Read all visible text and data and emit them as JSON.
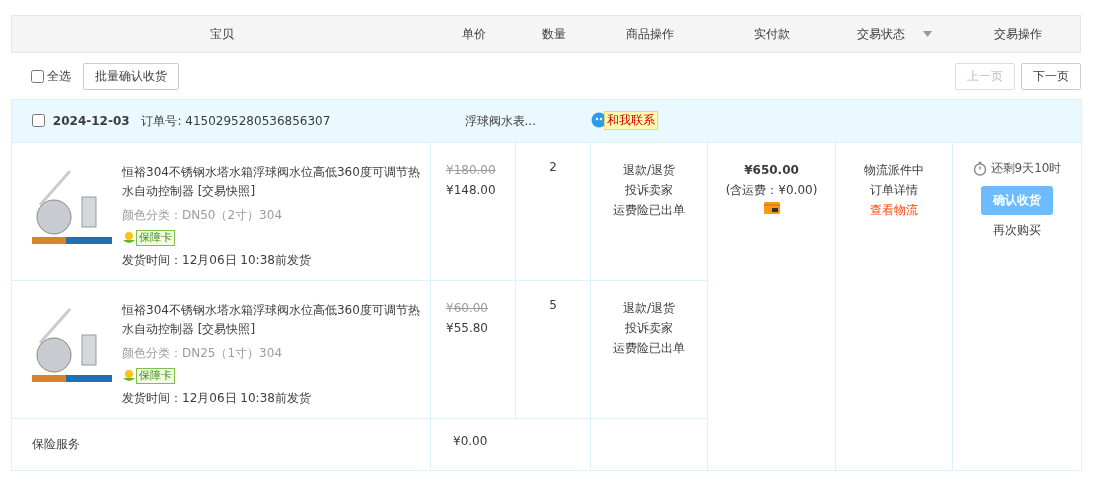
{
  "columns": [
    {
      "label": "宝贝",
      "dropdown": false
    },
    {
      "label": "单价",
      "dropdown": false
    },
    {
      "label": "数量",
      "dropdown": false
    },
    {
      "label": "商品操作",
      "dropdown": false
    },
    {
      "label": "实付款",
      "dropdown": false
    },
    {
      "label": "交易状态",
      "dropdown": true
    },
    {
      "label": "交易操作",
      "dropdown": false
    }
  ],
  "toolbar": {
    "select_all": {
      "label": "全选",
      "checked": false
    },
    "batch_button": "批量确认收货",
    "pager": [
      {
        "label": "上一页",
        "disabled": true
      },
      {
        "label": "下一页",
        "disabled": false
      }
    ]
  },
  "order": {
    "checked": false,
    "date": "2024-12-03",
    "order_no_label": "订单号:",
    "order_no": "4150295280536856307",
    "shop": "浮球阀水表...",
    "contact": "和我联系",
    "items": [
      {
        "title": "恒裕304不锈钢水塔水箱浮球阀水位高低360度可调节热水自动控制器",
        "snapshot": "[交易快照]",
        "spec": "颜色分类：DN50（2寸）304",
        "badge": "保障卡",
        "ship": "发货时间：12月06日 10:38前发货",
        "original_price": "¥180.00",
        "price": "¥148.00",
        "qty": "2",
        "actions": [
          "退款/退货",
          "投诉卖家",
          "运费险已出单"
        ]
      },
      {
        "title": "恒裕304不锈钢水塔水箱浮球阀水位高低360度可调节热水自动控制器",
        "snapshot": "[交易快照]",
        "spec": "颜色分类：DN25（1寸）304",
        "badge": "保障卡",
        "ship": "发货时间：12月06日 10:38前发货",
        "original_price": "¥60.00",
        "price": "¥55.80",
        "qty": "5",
        "actions": [
          "退款/退货",
          "投诉卖家",
          "运费险已出单"
        ]
      }
    ],
    "insurance": {
      "label": "保险服务",
      "price": "¥0.00"
    },
    "total": "¥650.00",
    "shipping": "(含运费：¥0.00)",
    "status": [
      {
        "text": "物流派件中",
        "kind": "text"
      },
      {
        "text": "订单详情",
        "kind": "link"
      },
      {
        "text": "查看物流",
        "kind": "alert"
      }
    ],
    "countdown": "还剩9天10时",
    "confirm_button": "确认收货",
    "rebuy": "再次购买"
  }
}
